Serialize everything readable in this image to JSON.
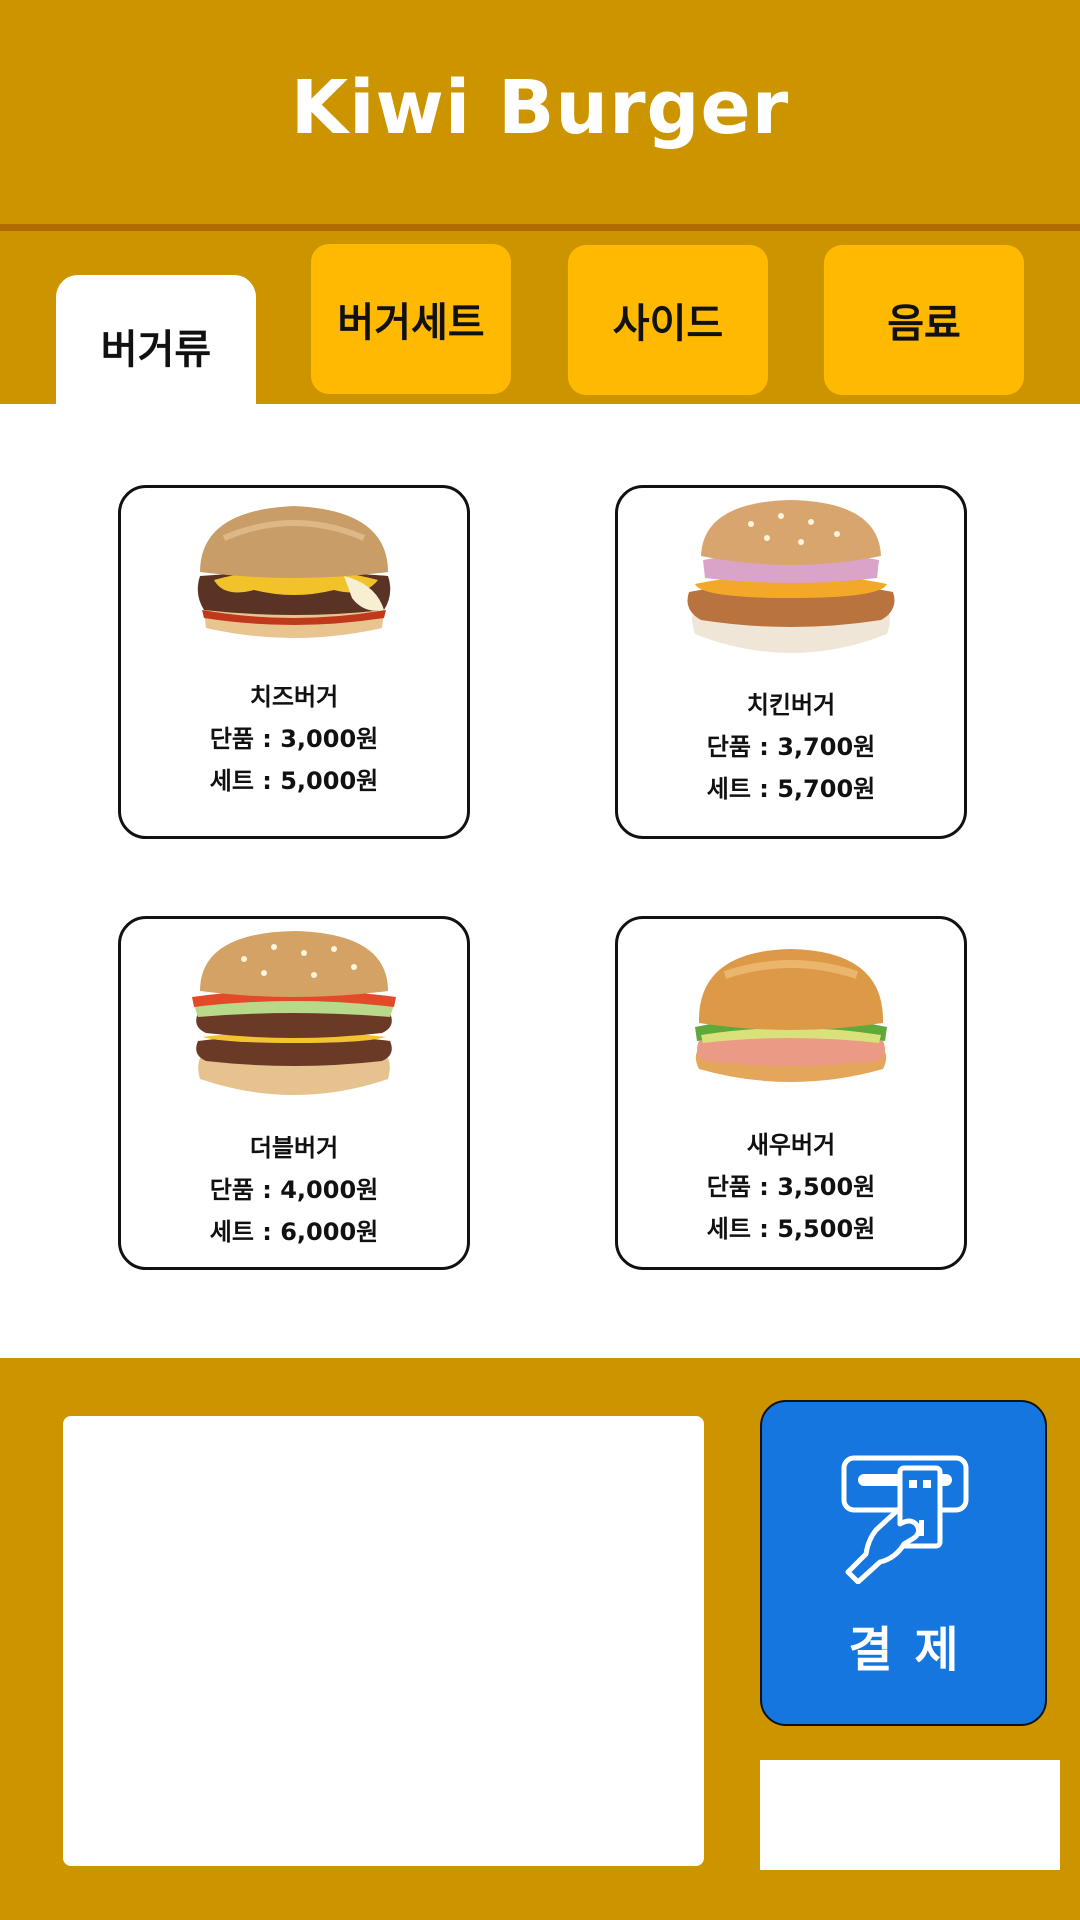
{
  "header": {
    "title": "Kiwi Burger"
  },
  "tabs": [
    {
      "label": "버거류",
      "active": true
    },
    {
      "label": "버거세트",
      "active": false
    },
    {
      "label": "사이드",
      "active": false
    },
    {
      "label": "음료",
      "active": false
    }
  ],
  "menu": [
    {
      "name": "치즈버거",
      "single": "단품 : 3,000원",
      "set": "세트 : 5,000원",
      "image": "cheeseburger-image"
    },
    {
      "name": "치킨버거",
      "single": "단품 : 3,700원",
      "set": "세트 : 5,700원",
      "image": "chicken-burger-image"
    },
    {
      "name": "더블버거",
      "single": "단품 : 4,000원",
      "set": "세트 : 6,000원",
      "image": "double-burger-image"
    },
    {
      "name": "새우버거",
      "single": "단품 : 3,500원",
      "set": "세트 : 5,500원",
      "image": "shrimp-burger-image"
    }
  ],
  "footer": {
    "pay_label": "결제",
    "pay_icon": "card-payment-icon"
  },
  "colors": {
    "brand": "#cc9500",
    "header_line": "#b36b00",
    "tab": "#ffb900",
    "pay_button": "#1476de"
  }
}
